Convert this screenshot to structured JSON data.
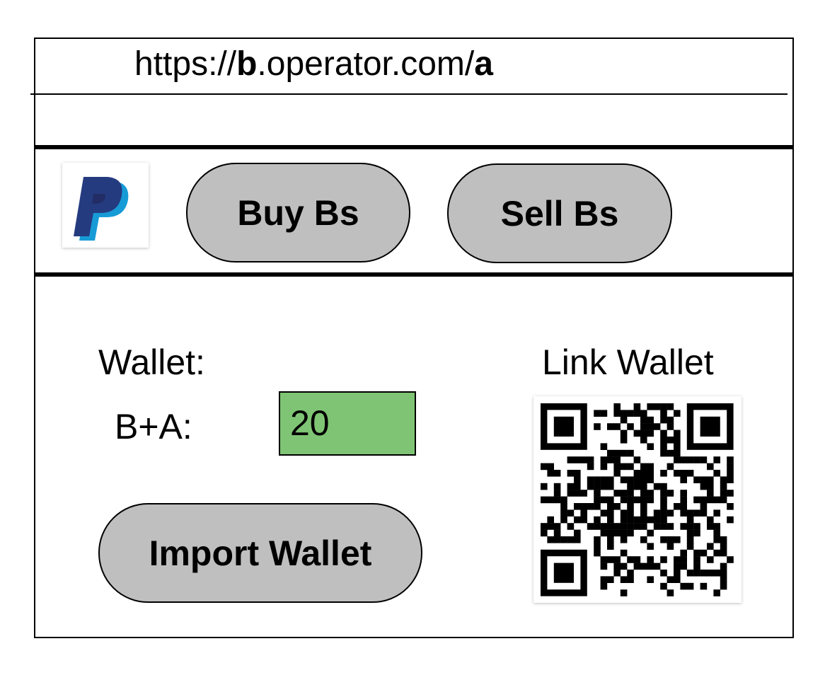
{
  "address_bar": {
    "url_prefix": "https://",
    "url_host_bold": "b",
    "url_domain": ".operator.com/",
    "url_path_bold": "a"
  },
  "nav": {
    "logo_icon": "paypal-logo-icon",
    "buy_label": "Buy Bs",
    "sell_label": "Sell Bs"
  },
  "wallet": {
    "wallet_label": "Wallet:",
    "balance_label": "B+A:",
    "balance_value": "20",
    "balance_color": "#7fc474",
    "import_label": "Import Wallet"
  },
  "link": {
    "title": "Link Wallet",
    "qr_icon": "qr-code-icon"
  },
  "colors": {
    "button_fill": "#bfbfbf",
    "paypal_dark": "#253b80",
    "paypal_light": "#179bd7"
  }
}
